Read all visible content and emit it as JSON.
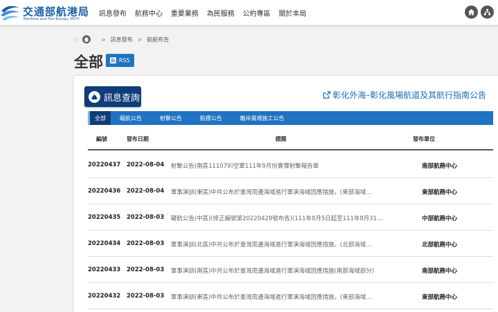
{
  "header": {
    "logo_cn": "交通部航港局",
    "logo_en": "Maritime and Port Bureau, MOTC",
    "nav": [
      "訊息發布",
      "航務中心",
      "重要業務",
      "為民服務",
      "公約專區",
      "關於本局"
    ],
    "icons": [
      "home-icon",
      "sitemap-icon"
    ]
  },
  "breadcrumb": {
    "dots": ":::",
    "items": [
      "訊息發布",
      "航船布告"
    ]
  },
  "page": {
    "title": "全部",
    "rss_label": "RSS"
  },
  "card": {
    "query_label": "訊息查詢",
    "promo_link": "彰化外海–彰化風場航道及其航行指南公告",
    "tabs": [
      "全部",
      "礙航公告",
      "射擊公告",
      "航標公告",
      "離岸風場施工公告"
    ],
    "active_tab": 0,
    "columns": [
      "編號",
      "發布日期",
      "標題",
      "發布單位"
    ],
    "rows": [
      {
        "no": "20220437",
        "date": "2022-08-04",
        "title": "射擊公告(南區111079)空軍111年9月份實彈射擊報告單",
        "unit": "南部航務中心"
      },
      {
        "no": "20220436",
        "date": "2022-08-04",
        "title": "軍事演訓(東區)中共公布於臺灣周邊海域進行軍演海域因應措施，(東部海域…",
        "unit": "東部航務中心"
      },
      {
        "no": "20220435",
        "date": "2022-08-03",
        "title": "礙航公告(中區)(修正編號第20220428號布告)(111年8月5日起至111年8月31…",
        "unit": "中部航務中心"
      },
      {
        "no": "20220434",
        "date": "2022-08-03",
        "title": "軍事演訓(北區)中共公布於臺灣周邊海域進行軍演海域因應措施，(北部海域…",
        "unit": "北部航務中心"
      },
      {
        "no": "20220433",
        "date": "2022-08-03",
        "title": "軍事演訓(南區)中共公布於臺灣周邊海域進行軍演海域因應措施(南部海域部分)",
        "unit": "南部航務中心"
      },
      {
        "no": "20220432",
        "date": "2022-08-03",
        "title": "軍事演訓(東區)中共公布於臺灣周邊海域進行軍演海域因應措施，(東部海域…",
        "unit": "東部航務中心"
      }
    ]
  },
  "colors": {
    "brand": "#1a5fa8",
    "tab_bar": "#1f73c2",
    "tab_active": "#0f3d7a",
    "link": "#1a6db5"
  }
}
